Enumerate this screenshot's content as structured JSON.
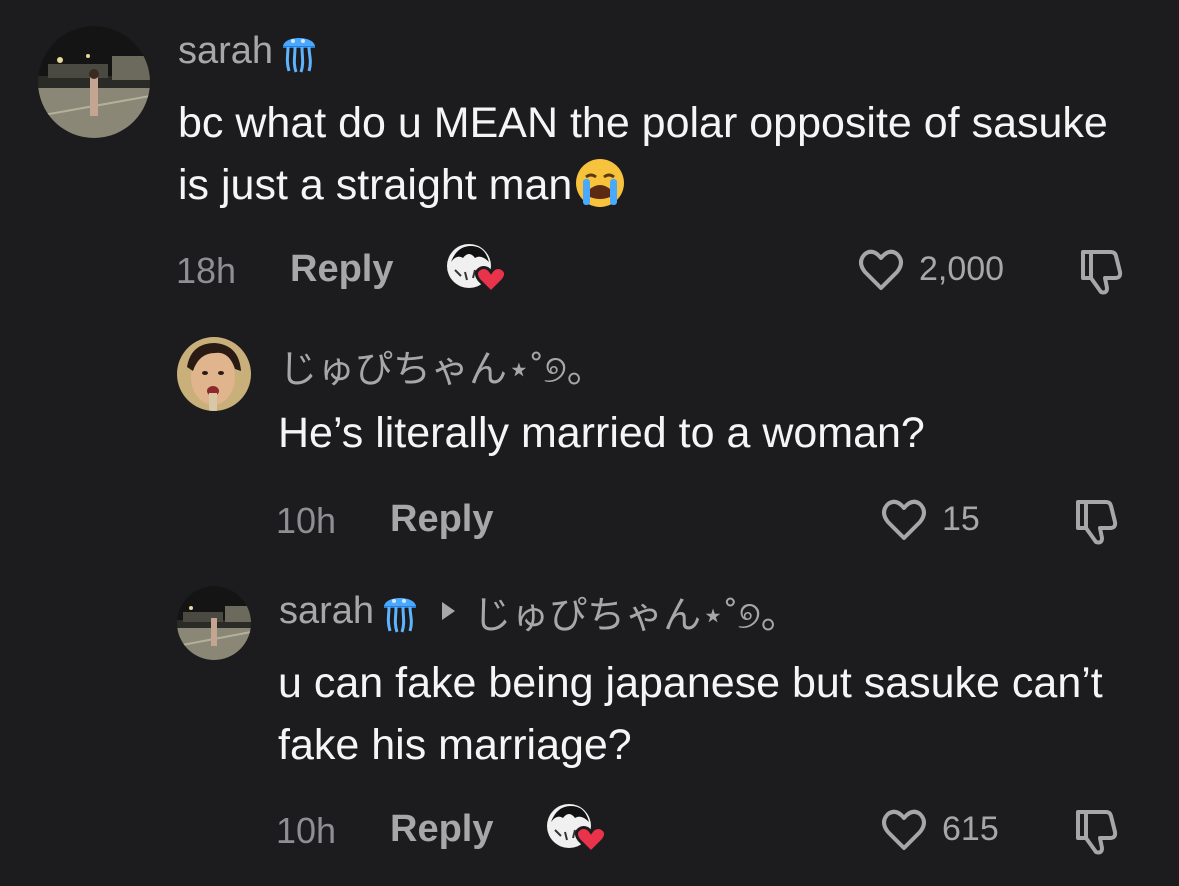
{
  "comments": [
    {
      "username": "sarah",
      "username_icon": "jellyfish-emoji",
      "text": "bc what do u MEAN the polar opposite of sasuke is just a straight man",
      "text_emoji": "loudly-crying-emoji",
      "time": "18h",
      "reply_label": "Reply",
      "liked_by_creator": true,
      "likes": "2,000"
    },
    {
      "username": "じゅぴちゃん⋆˚୭。",
      "text": "He’s literally married to a woman?",
      "time": "10h",
      "reply_label": "Reply",
      "liked_by_creator": false,
      "likes": "15"
    },
    {
      "username": "sarah",
      "username_icon": "jellyfish-emoji",
      "reply_to": "じゅぴちゃん⋆˚୭。",
      "text": "u can fake being japanese but sasuke can’t fake his marriage?",
      "time": "10h",
      "reply_label": "Reply",
      "liked_by_creator": true,
      "likes": "615"
    }
  ],
  "colors": {
    "background": "#1c1c1e",
    "primary_text": "#f5f5f5",
    "secondary_text": "#a7a7aa",
    "creator_heart": "#e8334a"
  }
}
